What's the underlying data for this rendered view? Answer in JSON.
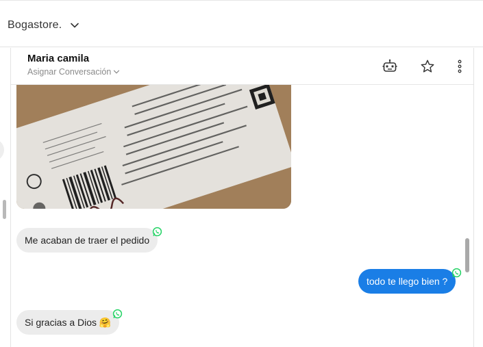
{
  "store": {
    "name": "Bogastore.",
    "icon": "chevron-down-icon"
  },
  "chat": {
    "contact_name": "Maria camila",
    "assign_label": "Asignar Conversación",
    "header_icons": [
      "robot-icon",
      "star-icon",
      "more-vertical-icon"
    ]
  },
  "messages": [
    {
      "type": "image",
      "direction": "in",
      "description_icon": "photo-shipping-label"
    },
    {
      "type": "text",
      "direction": "in",
      "text": "Me acaban de traer el pedido",
      "channel_icon": "whatsapp-icon"
    },
    {
      "type": "text",
      "direction": "out",
      "text": "todo te llego bien ?",
      "channel_icon": "whatsapp-icon"
    },
    {
      "type": "text",
      "direction": "in",
      "text": "Si gracias a Dios 🤗",
      "channel_icon": "whatsapp-icon"
    }
  ],
  "colors": {
    "outgoing_bubble": "#1a7ee6",
    "incoming_bubble": "#ececec",
    "whatsapp": "#25d366"
  }
}
